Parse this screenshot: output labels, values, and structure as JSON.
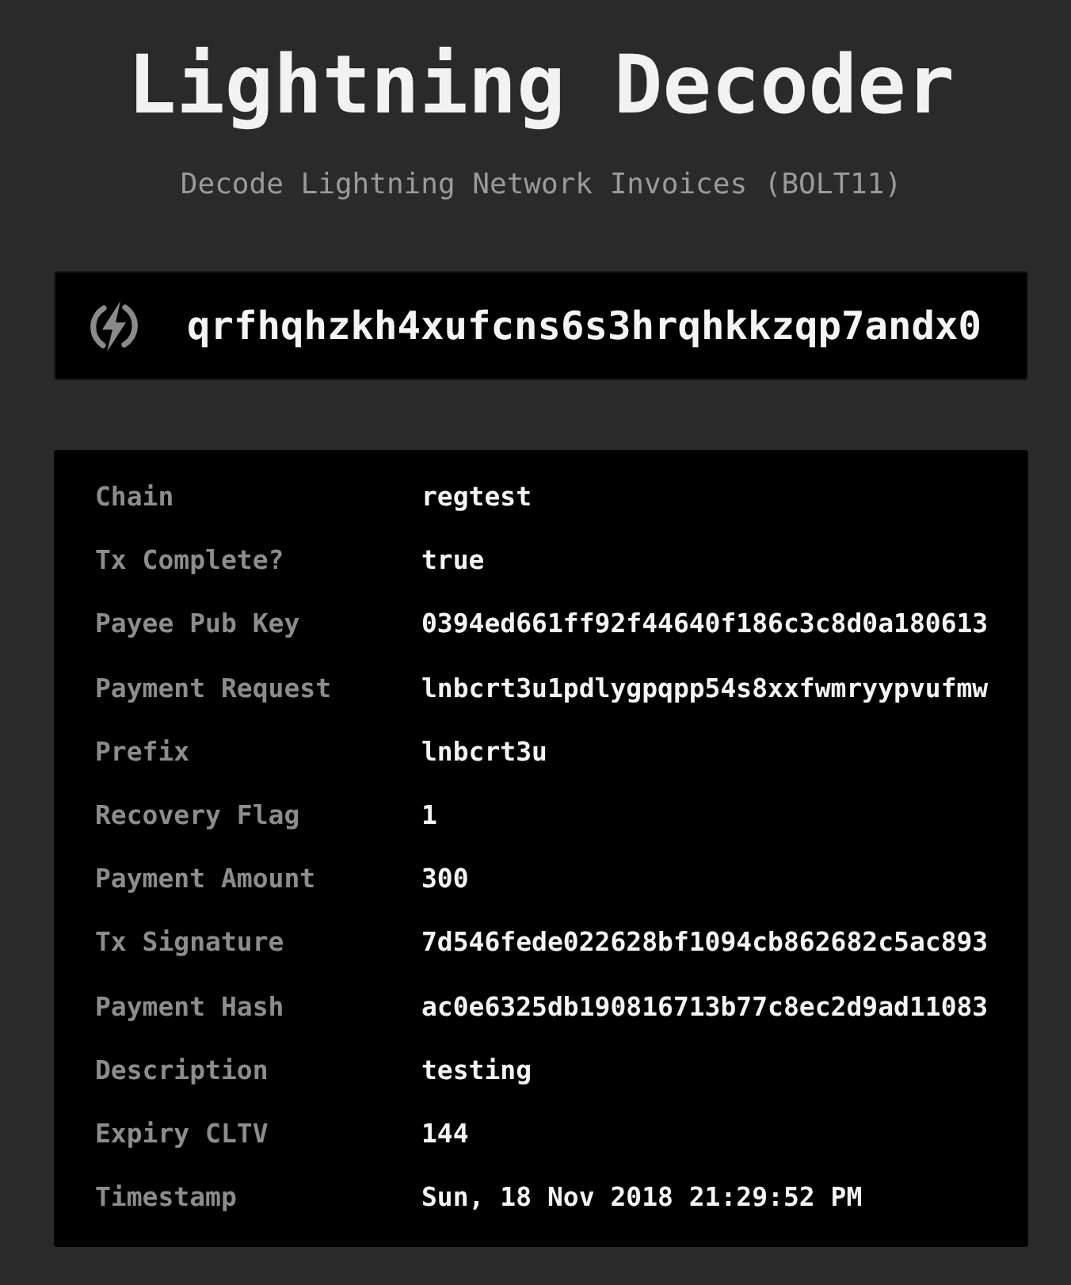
{
  "header": {
    "title": "Lightning Decoder",
    "subtitle": "Decode Lightning Network Invoices (BOLT11)"
  },
  "invoice_input": {
    "value": "qrfhqhzkh4xufcns6s3hrqhkkzqp7andx0"
  },
  "fields": [
    {
      "label": "Chain",
      "value": "regtest"
    },
    {
      "label": "Tx Complete?",
      "value": "true"
    },
    {
      "label": "Payee Pub Key",
      "value": "0394ed661ff92f44640f186c3c8d0a180613"
    },
    {
      "label": "Payment Request",
      "value": "lnbcrt3u1pdlygpqpp54s8xxfwmryypvufmw"
    },
    {
      "label": "Prefix",
      "value": "lnbcrt3u"
    },
    {
      "label": "Recovery Flag",
      "value": "1"
    },
    {
      "label": "Payment Amount",
      "value": "300"
    },
    {
      "label": "Tx Signature",
      "value": "7d546fede022628bf1094cb862682c5ac893"
    },
    {
      "label": "Payment Hash",
      "value": "ac0e6325db190816713b77c8ec2d9ad11083"
    },
    {
      "label": "Description",
      "value": "testing"
    },
    {
      "label": "Expiry CLTV",
      "value": "144"
    },
    {
      "label": "Timestamp",
      "value": "Sun, 18 Nov 2018 21:29:52 PM"
    }
  ]
}
